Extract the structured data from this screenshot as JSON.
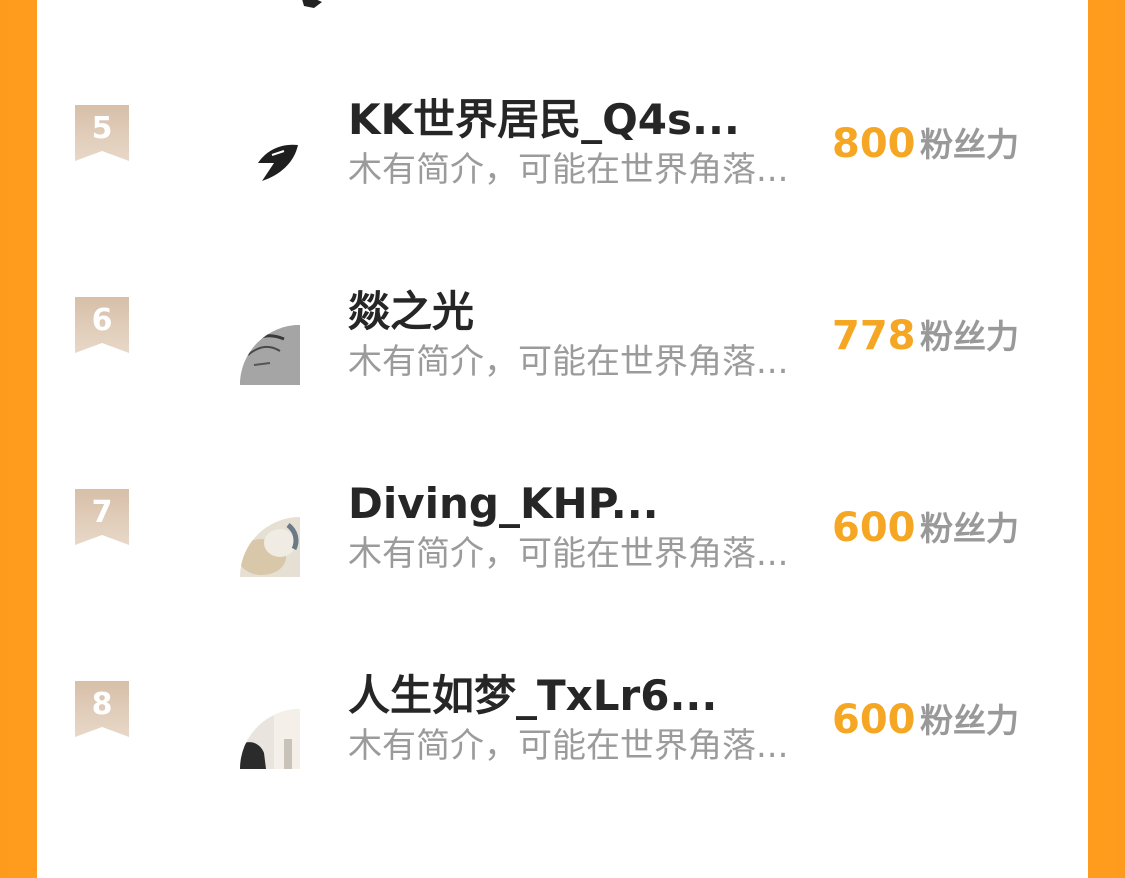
{
  "accent_color": "#f5a623",
  "badge_color": "#c4a78d",
  "rows": [
    {
      "rank": "5",
      "name": "KK世界居民_Q4s...",
      "bio": "木有简介，可能在世界角落...",
      "score": "800",
      "unit": "粉丝力",
      "avatar_icon": "fish-fin-avatar"
    },
    {
      "rank": "6",
      "name": "燚之光",
      "bio": "木有简介，可能在世界角落...",
      "score": "778",
      "unit": "粉丝力",
      "avatar_icon": "sketch-photo-avatar"
    },
    {
      "rank": "7",
      "name": "Diving_KHP...",
      "bio": "木有简介，可能在世界角落...",
      "score": "600",
      "unit": "粉丝力",
      "avatar_icon": "pet-photo-avatar"
    },
    {
      "rank": "8",
      "name": "人生如梦_TxLr6...",
      "bio": "木有简介，可能在世界角落...",
      "score": "600",
      "unit": "粉丝力",
      "avatar_icon": "room-photo-avatar"
    }
  ]
}
